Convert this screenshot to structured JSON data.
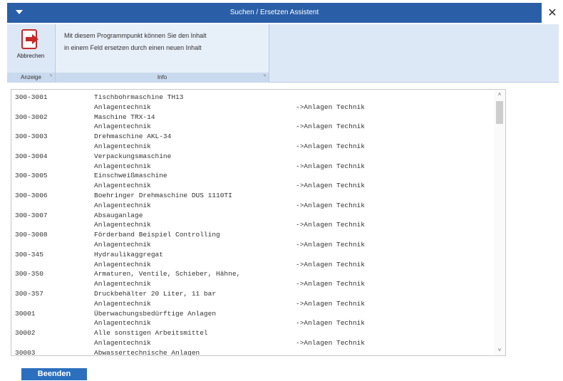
{
  "window": {
    "title": "Suchen / Ersetzen Assistent",
    "close_glyph": "✕",
    "menu_icon": "chevron-down-icon"
  },
  "ribbon": {
    "anzeige_group": {
      "label": "Anzeige",
      "abbrechen_label": "Abbrechen",
      "abbrechen_icon": "exit-arrow-icon"
    },
    "info_group": {
      "label": "Info",
      "line1": "Mit diesem Programmpunkt können Sie den Inhalt",
      "line2": "in einem Feld ersetzen durch einen neuen Inhalt"
    }
  },
  "list": {
    "rows": [
      {
        "code": "300-3001",
        "text": "Tischbohrmaschine TH13",
        "target": ""
      },
      {
        "code": "",
        "text": "Anlagentechnik",
        "target": "->Anlagen Technik"
      },
      {
        "code": "300-3002",
        "text": "Maschine TRX-14",
        "target": ""
      },
      {
        "code": "",
        "text": "Anlagentechnik",
        "target": "->Anlagen Technik"
      },
      {
        "code": "300-3003",
        "text": "Drehmaschine AKL-34",
        "target": ""
      },
      {
        "code": "",
        "text": "Anlagentechnik",
        "target": "->Anlagen Technik"
      },
      {
        "code": "300-3004",
        "text": "Verpackungsmaschine",
        "target": ""
      },
      {
        "code": "",
        "text": "Anlagentechnik",
        "target": "->Anlagen Technik"
      },
      {
        "code": "300-3005",
        "text": "Einschweißmaschine",
        "target": ""
      },
      {
        "code": "",
        "text": "Anlagentechnik",
        "target": "->Anlagen Technik"
      },
      {
        "code": "300-3006",
        "text": "Boehringer Drehmaschine DUS 1110TI",
        "target": ""
      },
      {
        "code": "",
        "text": "Anlagentechnik",
        "target": "->Anlagen Technik"
      },
      {
        "code": "300-3007",
        "text": "Absauganlage",
        "target": ""
      },
      {
        "code": "",
        "text": "Anlagentechnik",
        "target": "->Anlagen Technik"
      },
      {
        "code": "300-3008",
        "text": "Förderband Beispiel Controlling",
        "target": ""
      },
      {
        "code": "",
        "text": "Anlagentechnik",
        "target": "->Anlagen Technik"
      },
      {
        "code": "300-345",
        "text": "Hydraulikaggregat",
        "target": ""
      },
      {
        "code": "",
        "text": "Anlagentechnik",
        "target": "->Anlagen Technik"
      },
      {
        "code": "300-350",
        "text": "Armaturen, Ventile, Schieber, Hähne,",
        "target": ""
      },
      {
        "code": "",
        "text": "Anlagentechnik",
        "target": "->Anlagen Technik"
      },
      {
        "code": "300-357",
        "text": "Druckbehälter 20 Liter, 11 bar",
        "target": ""
      },
      {
        "code": "",
        "text": "Anlagentechnik",
        "target": "->Anlagen Technik"
      },
      {
        "code": "30001",
        "text": "Überwachungsbedürftige Anlagen",
        "target": ""
      },
      {
        "code": "",
        "text": "Anlagentechnik",
        "target": "->Anlagen Technik"
      },
      {
        "code": "30002",
        "text": "Alle sonstigen Arbeitsmittel",
        "target": ""
      },
      {
        "code": "",
        "text": "Anlagentechnik",
        "target": "->Anlagen Technik"
      },
      {
        "code": "30003",
        "text": "Abwassertechnische Anlagen",
        "target": ""
      }
    ],
    "scroll_up_glyph": "˄",
    "scroll_down_glyph": "˅"
  },
  "footer": {
    "beenden_label": "Beenden"
  },
  "colors": {
    "title_bar": "#2a5fa8",
    "ribbon_bg": "#dde8f6",
    "button_blue": "#2c6fbf",
    "exit_icon_red": "#c62828"
  }
}
